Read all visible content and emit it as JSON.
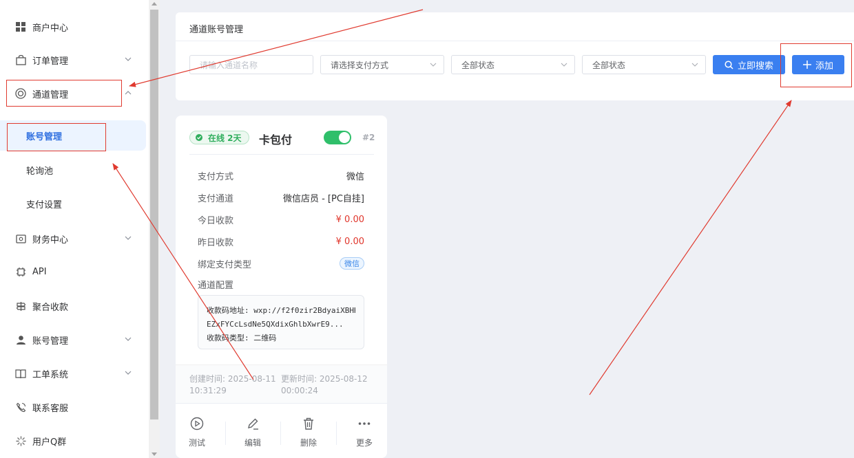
{
  "sidebar": {
    "items": [
      {
        "label": "商户中心",
        "icon": "grid-icon",
        "has_children": false
      },
      {
        "label": "订单管理",
        "icon": "bag-icon",
        "has_children": true
      },
      {
        "label": "通道管理",
        "icon": "ring-icon",
        "has_children": true,
        "expanded": true
      },
      {
        "label": "财务中心",
        "icon": "wallet-icon",
        "has_children": true
      },
      {
        "label": "API",
        "icon": "chip-icon",
        "has_children": false
      },
      {
        "label": "聚合收款",
        "icon": "signpost-icon",
        "has_children": false
      },
      {
        "label": "账号管理",
        "icon": "user-icon",
        "has_children": true
      },
      {
        "label": "工单系统",
        "icon": "book-icon",
        "has_children": true
      },
      {
        "label": "联系客服",
        "icon": "phone-icon",
        "has_children": false
      },
      {
        "label": "用户Q群",
        "icon": "spinner-icon",
        "has_children": false
      }
    ],
    "subitems": [
      {
        "label": "账号管理",
        "active": true
      },
      {
        "label": "轮询池",
        "active": false
      },
      {
        "label": "支付设置",
        "active": false
      }
    ]
  },
  "filter": {
    "title": "通道账号管理",
    "name_placeholder": "请输入通道名称",
    "pay_method": "请选择支付方式",
    "status1": "全部状态",
    "status2": "全部状态",
    "search_label": "立即搜索",
    "add_label": "添加"
  },
  "card": {
    "status": "在线 2天",
    "title": "卡包付",
    "enabled": true,
    "id": "#2",
    "rows": [
      {
        "key": "支付方式",
        "value": "微信"
      },
      {
        "key": "支付通道",
        "value": "微信店员 - [PC自挂]"
      },
      {
        "key": "今日收款",
        "value": "¥ 0.00"
      },
      {
        "key": "昨日收款",
        "value": "¥ 0.00"
      }
    ],
    "bind_type_label": "绑定支付类型",
    "bind_type_tag": "微信",
    "config_label": "通道配置",
    "config_lines": [
      "收款码地址: wxp://f2f0zir2BdyaiXBHH",
      "EZxFYCcLsdNe5QXdixGhlbXwrE9...",
      "收款码类型: 二维码"
    ],
    "created_label": "创建时间: 2025-08-11",
    "created_time": "10:31:29",
    "updated_label": "更新时间: 2025-08-12",
    "updated_time": "00:00:24",
    "actions": [
      {
        "label": "测试",
        "icon": "play-circle-icon"
      },
      {
        "label": "编辑",
        "icon": "pencil-icon"
      },
      {
        "label": "删除",
        "icon": "trash-icon"
      },
      {
        "label": "更多",
        "icon": "more-dots-icon"
      }
    ]
  },
  "colors": {
    "primary": "#3a7ff0",
    "success": "#2fbf6a",
    "danger": "#e0352b",
    "annotation": "#e03a2f"
  }
}
